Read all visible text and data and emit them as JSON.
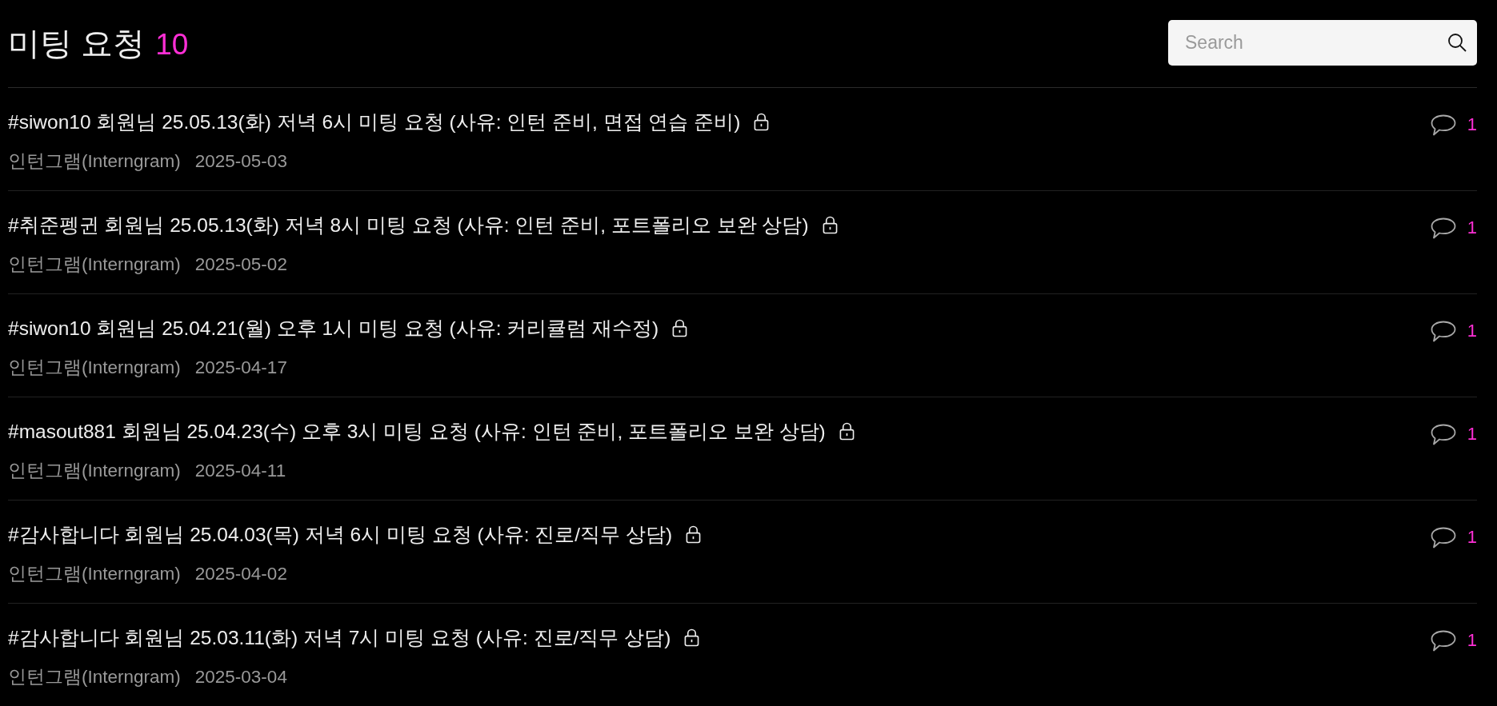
{
  "header": {
    "title": "미팅 요청",
    "count": "10"
  },
  "search": {
    "placeholder": "Search"
  },
  "posts": [
    {
      "title": "#siwon10 회원님 25.05.13(화) 저녁 6시 미팅 요청 (사유: 인턴 준비, 면접 연습 준비)",
      "locked": true,
      "author": "인턴그램(Interngram)",
      "date": "2025-05-03",
      "comments": "1"
    },
    {
      "title": "#취준펭귄 회원님 25.05.13(화) 저녁 8시 미팅 요청 (사유: 인턴 준비, 포트폴리오 보완 상담)",
      "locked": true,
      "author": "인턴그램(Interngram)",
      "date": "2025-05-02",
      "comments": "1"
    },
    {
      "title": "#siwon10 회원님 25.04.21(월) 오후 1시 미팅 요청 (사유: 커리큘럼 재수정)",
      "locked": true,
      "author": "인턴그램(Interngram)",
      "date": "2025-04-17",
      "comments": "1"
    },
    {
      "title": "#masout881 회원님 25.04.23(수) 오후 3시 미팅 요청 (사유: 인턴 준비, 포트폴리오 보완 상담)",
      "locked": true,
      "author": "인턴그램(Interngram)",
      "date": "2025-04-11",
      "comments": "1"
    },
    {
      "title": "#감사합니다 회원님 25.04.03(목) 저녁 6시 미팅 요청 (사유: 진로/직무 상담)",
      "locked": true,
      "author": "인턴그램(Interngram)",
      "date": "2025-04-02",
      "comments": "1"
    },
    {
      "title": "#감사합니다 회원님 25.03.11(화) 저녁 7시 미팅 요청 (사유: 진로/직무 상담)",
      "locked": true,
      "author": "인턴그램(Interngram)",
      "date": "2025-03-04",
      "comments": "1"
    }
  ]
}
